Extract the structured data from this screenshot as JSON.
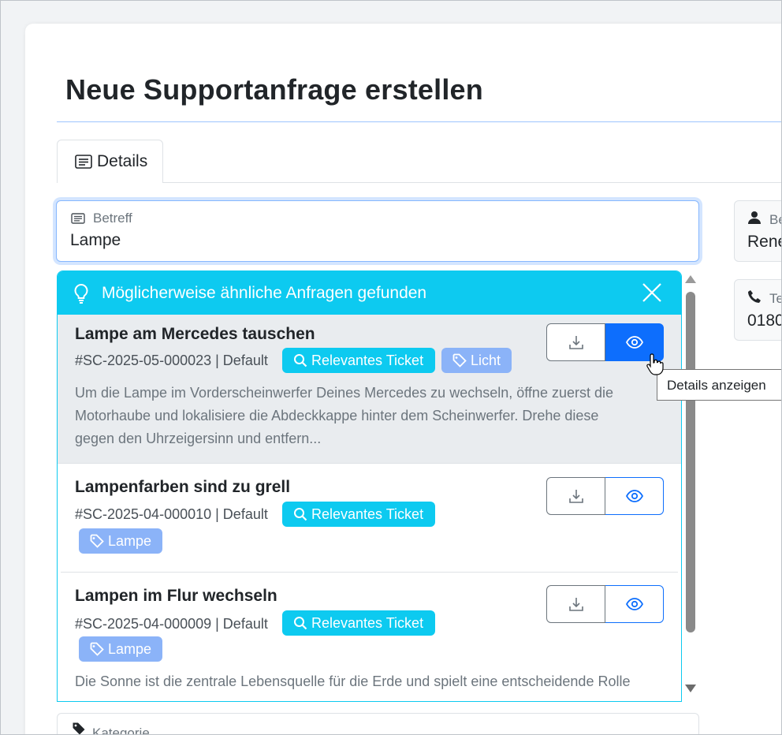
{
  "page": {
    "title": "Neue Supportanfrage erstellen"
  },
  "tabs": [
    {
      "label": "Details"
    }
  ],
  "subject": {
    "label": "Betreff",
    "value": "Lampe"
  },
  "right_fields": [
    {
      "label": "Be",
      "value": "Rene"
    },
    {
      "label": "Te",
      "value": "0180"
    }
  ],
  "suggestions": {
    "header": "Möglicherweise ähnliche Anfragen gefunden",
    "relevant_label": "Relevantes Ticket",
    "items": [
      {
        "title": "Lampe am Mercedes tauschen",
        "meta": "#SC-2025-05-000023 | Default",
        "tag": "Licht",
        "desc": [
          "Um die Lampe im Vorderscheinwerfer Deines Mercedes zu wechseln, öffne zuerst die",
          "Motorhaube und lokalisiere die Abdeckkappe hinter dem Scheinwerfer. Drehe diese",
          "gegen den Uhrzeigersinn und entfern..."
        ]
      },
      {
        "title": "Lampenfarben sind zu grell",
        "meta": "#SC-2025-04-000010 | Default",
        "tag": "Lampe"
      },
      {
        "title": "Lampen im Flur wechseln",
        "meta": "#SC-2025-04-000009 | Default",
        "tag": "Lampe",
        "desc": [
          "Die Sonne ist die zentrale Lebensquelle für die Erde und spielt eine entscheidende Rolle"
        ]
      }
    ]
  },
  "tooltip": "Details anzeigen",
  "category": {
    "label": "Kategorie"
  },
  "colors": {
    "accent": "#0dcaf0",
    "primary": "#0d6efd",
    "tag": "#8bb3f8",
    "active_row": "#e9ecef"
  },
  "icons": {
    "tab": "list-icon",
    "subject": "list-icon",
    "header": "lightbulb-icon",
    "close": "close-icon",
    "download": "download-icon",
    "view": "eye-icon",
    "tag": "tag-icon",
    "search": "search-icon"
  }
}
